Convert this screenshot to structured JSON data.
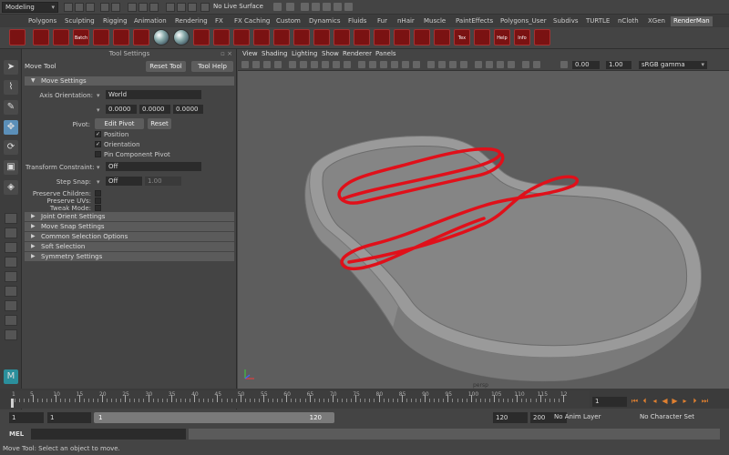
{
  "status_line": {
    "mode": "Modeling",
    "live_surface": "No Live Surface"
  },
  "shelf_tabs": [
    "Polygons",
    "Sculpting",
    "Rigging",
    "Animation",
    "Rendering",
    "FX",
    "FX Caching",
    "Custom",
    "Dynamics",
    "Fluids",
    "Fur",
    "nHair",
    "Muscle",
    "PaintEffects",
    "Polygons_User",
    "Subdivs",
    "TURTLE",
    "nCloth",
    "XGen",
    "RenderMan"
  ],
  "active_shelf_tab": "RenderMan",
  "shelf_icon_labels": {
    "batch": "Batch",
    "tex": "Tex",
    "help": "Help",
    "info": "Info"
  },
  "tool_settings": {
    "panel_title": "Tool Settings",
    "tool_name": "Move Tool",
    "reset_tool": "Reset Tool",
    "tool_help": "Tool Help",
    "move_settings": "Move Settings",
    "axis_orientation_label": "Axis Orientation:",
    "axis_orientation_value": "World",
    "offsets": [
      "0.0000",
      "0.0000",
      "0.0000"
    ],
    "pivot_label": "Pivot:",
    "edit_pivot": "Edit Pivot",
    "reset": "Reset",
    "position": "Position",
    "orientation": "Orientation",
    "pin_component_pivot": "Pin Component Pivot",
    "transform_constraint_label": "Transform Constraint:",
    "transform_constraint_value": "Off",
    "step_snap_label": "Step Snap:",
    "step_snap_value": "Off",
    "step_snap_amount": "1.00",
    "preserve_children": "Preserve Children:",
    "preserve_uvs": "Preserve UVs:",
    "tweak_mode": "Tweak Mode:",
    "sections": [
      "Joint Orient Settings",
      "Move Snap Settings",
      "Common Selection Options",
      "Soft Selection",
      "Symmetry Settings"
    ]
  },
  "viewport": {
    "menus": [
      "View",
      "Shading",
      "Lighting",
      "Show",
      "Renderer",
      "Panels"
    ],
    "exposure": "0.00",
    "gamma": "1.00",
    "color_space": "sRGB gamma",
    "camera_label": "persp",
    "colors": {
      "background": "#5d5d5d",
      "annotation": "#e0101a"
    }
  },
  "timeline": {
    "tick_labels": [
      "5",
      "10",
      "15",
      "20",
      "25",
      "30",
      "35",
      "40",
      "45",
      "50",
      "55",
      "60",
      "65",
      "70",
      "75",
      "80",
      "85",
      "90",
      "95",
      "100",
      "105",
      "110",
      "115",
      "12"
    ],
    "first_tick": "1",
    "current_frame": "1"
  },
  "range": {
    "start": "1",
    "anim_start": "1",
    "range_in": "1",
    "range_out": "120",
    "end": "120",
    "anim_end": "200",
    "anim_layer": "No Anim Layer",
    "character_set": "No Character Set"
  },
  "command_line": {
    "label": "MEL"
  },
  "help_line": "Move Tool: Select an object to move."
}
